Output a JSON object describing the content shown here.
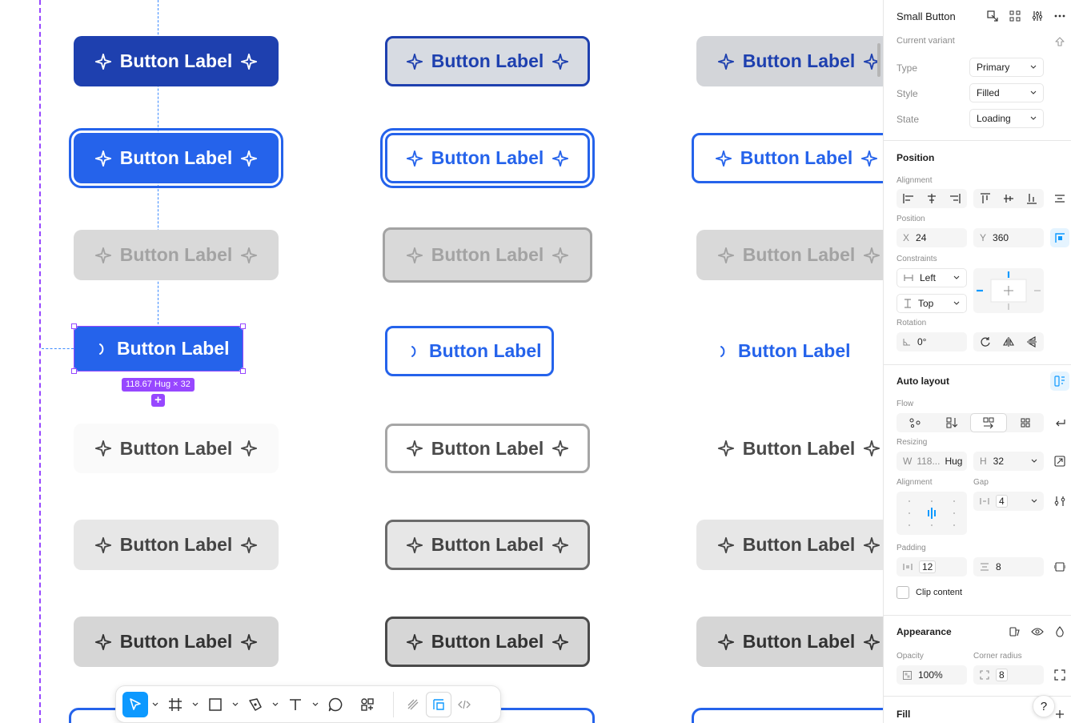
{
  "canvas": {
    "button_label": "Button Label",
    "selection_size": "118.67 Hug × 32",
    "add_symbol": "+"
  },
  "toolbar": {
    "tools": [
      "move-tool",
      "frame-tool",
      "shape-tool",
      "pen-tool",
      "text-tool",
      "comment-tool",
      "components-tool"
    ],
    "dev": [
      "draw-mode",
      "design-mode",
      "dev-mode"
    ]
  },
  "panel": {
    "component_name": "Small Button",
    "current_variant": "Current variant",
    "type_label": "Type",
    "type_value": "Primary",
    "style_label": "Style",
    "style_value": "Filled",
    "state_label": "State",
    "state_value": "Loading",
    "position_title": "Position",
    "alignment_label": "Alignment",
    "position_label": "Position",
    "x_prefix": "X",
    "x_value": "24",
    "y_prefix": "Y",
    "y_value": "360",
    "constraints_label": "Constraints",
    "constraint_h": "Left",
    "constraint_v": "Top",
    "rotation_label": "Rotation",
    "rotation_value": "0°",
    "auto_layout_title": "Auto layout",
    "flow_label": "Flow",
    "resizing_label": "Resizing",
    "w_prefix": "W",
    "w_value": "118...",
    "w_mode": "Hug",
    "h_prefix": "H",
    "h_value": "32",
    "al_alignment_label": "Alignment",
    "gap_label": "Gap",
    "gap_value": "4",
    "padding_label": "Padding",
    "padding_h": "12",
    "padding_v": "8",
    "clip_label": "Clip content",
    "appearance_title": "Appearance",
    "opacity_label": "Opacity",
    "opacity_value": "100%",
    "radius_label": "Corner radius",
    "radius_value": "8",
    "fill_title": "Fill",
    "help": "?"
  },
  "colors": {
    "primary": "#2563eb",
    "primary_dark": "#1e40af",
    "selection": "#9747ff",
    "toolbar_active": "#0d99ff"
  }
}
